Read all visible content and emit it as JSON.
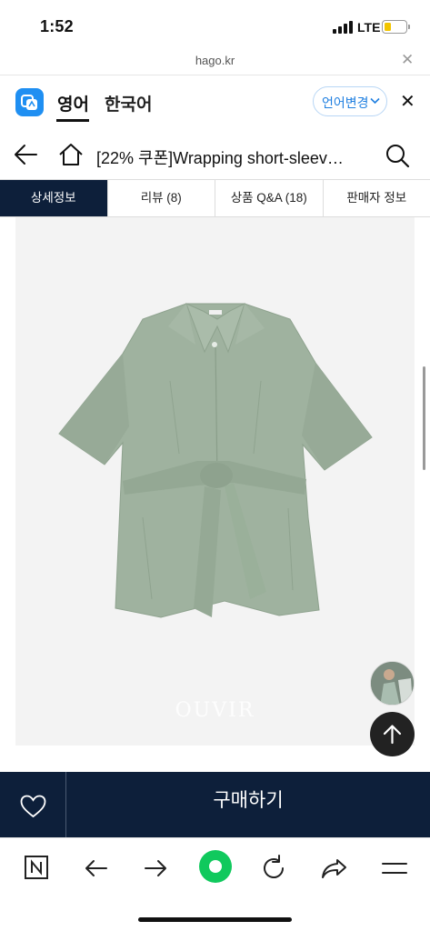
{
  "status_bar": {
    "time": "1:52",
    "network": "LTE"
  },
  "url_bar": {
    "url": "hago.kr",
    "close": "✕"
  },
  "translate_bar": {
    "active_language": "영어",
    "inactive_language": "한국어",
    "change_language_label": "언어변경",
    "close": "✕"
  },
  "header": {
    "title": "[22% 쿠폰]Wrapping short-sleeved shirt"
  },
  "tabs": [
    {
      "label": "상세정보",
      "active": true
    },
    {
      "label": "리뷰 (8)",
      "active": false
    },
    {
      "label": "상품 Q&A (18)",
      "active": false
    },
    {
      "label": "판매자 정보",
      "active": false
    }
  ],
  "product_image": {
    "watermark": "OUVIR",
    "shirt_color": "#9fb29f"
  },
  "purchase_bar": {
    "buy_label": "구매하기"
  },
  "colors": {
    "navy": "#0d1f3a",
    "accent_blue": "#1f8ff2",
    "naver_green": "#10c95d"
  },
  "browser_bar": {
    "items": [
      "naver-n-icon",
      "back-arrow-icon",
      "forward-arrow-icon",
      "green-dot-icon",
      "refresh-icon",
      "share-icon",
      "menu-icon"
    ]
  }
}
